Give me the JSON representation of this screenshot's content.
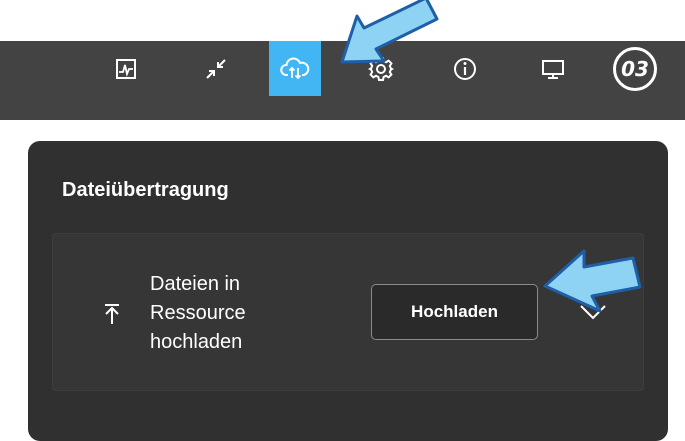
{
  "toolbar": {
    "buttons": [
      {
        "icon": "activity-icon"
      },
      {
        "icon": "collapse-icon"
      },
      {
        "icon": "cloud-upload-icon",
        "active": true
      },
      {
        "icon": "gear-icon"
      },
      {
        "icon": "info-icon"
      },
      {
        "icon": "monitor-icon"
      }
    ],
    "session_badge": "03"
  },
  "panel": {
    "title": "Dateiübertragung",
    "upload_card": {
      "label_lines": [
        "Dateien in",
        "Ressource",
        "hochladen"
      ],
      "button_label": "Hochladen"
    }
  },
  "colors": {
    "toolbar_bg": "#434343",
    "active_button": "#41b6f2",
    "panel_bg": "#303030",
    "callout_fill": "#8fd3f4",
    "callout_stroke": "#1f5fa8"
  }
}
